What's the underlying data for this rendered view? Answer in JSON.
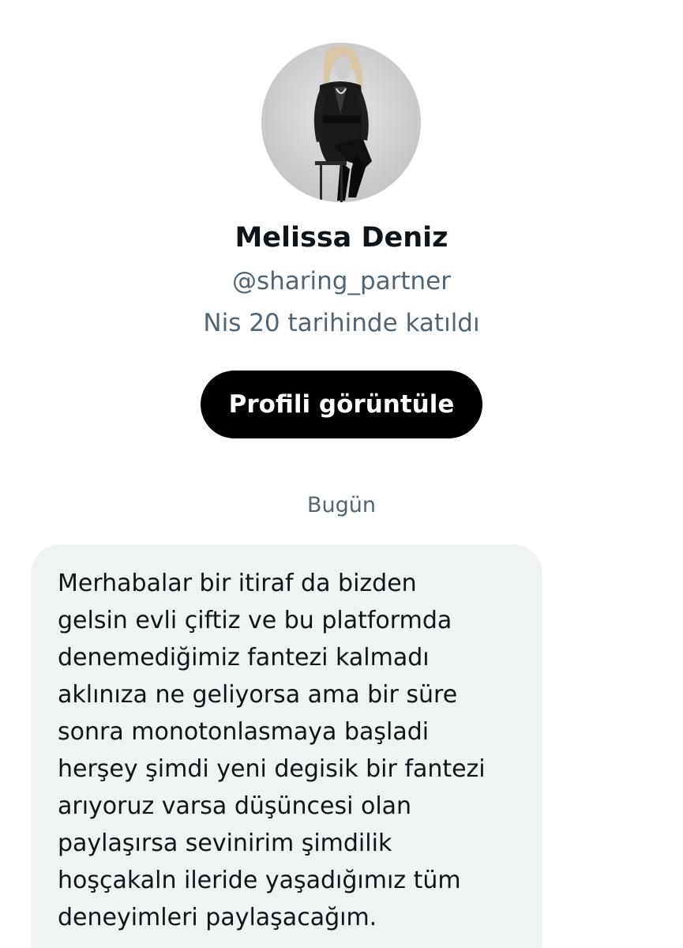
{
  "profile": {
    "display_name": "Melissa Deniz",
    "handle": "@sharing_partner",
    "joined": "Nis 20 tarihinde katıldı",
    "view_profile_label": "Profili görüntüle"
  },
  "conversation": {
    "date_label": "Bugün",
    "messages": [
      {
        "text": "Merhabalar bir itiraf da bizden\ngelsin evli çiftiz ve bu platformda\ndenemediğimiz fantezi kalmadı\naklınıza ne geliyorsa ama bir süre\nsonra monotonlasmaya başladi\nherşey şimdi yeni degisik bir fantezi\narıyoruz varsa düşüncesi olan\npaylaşırsa sevinirim şimdilik\nhoşçakaln ileride yaşadığımız tüm\ndeneyimleri paylaşacağım."
      }
    ]
  },
  "colors": {
    "primary_text": "#0f1419",
    "secondary_text": "#536471",
    "button_bg": "#000000",
    "bubble_bg": "#eff3f4"
  }
}
